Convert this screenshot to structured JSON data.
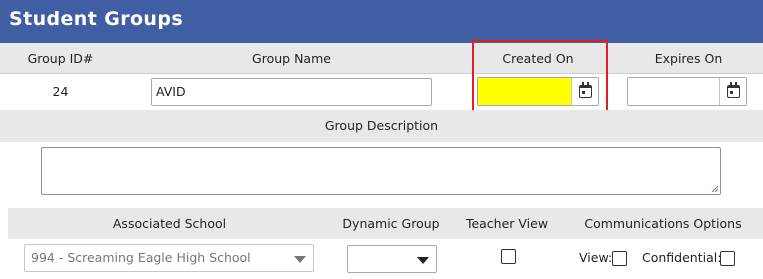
{
  "header": {
    "title": "Student Groups"
  },
  "columns": {
    "group_id": "Group ID#",
    "group_name": "Group Name",
    "created_on": "Created On",
    "expires_on": "Expires On"
  },
  "row": {
    "group_id": "24",
    "group_name": "AVID",
    "created_on": "",
    "expires_on": ""
  },
  "description": {
    "label": "Group Description",
    "value": ""
  },
  "associated": {
    "headers": {
      "school": "Associated School",
      "dynamic": "Dynamic Group",
      "teacher": "Teacher View",
      "comms": "Communications Options"
    },
    "school_value": "994 - Screaming Eagle High School",
    "dynamic_value": "",
    "view_label": "View:",
    "confidential_label": "Confidential:"
  },
  "colors": {
    "header_bg": "#3f5ea3",
    "created_on_fill": "#ffff00",
    "highlight_border": "#e02020"
  },
  "icons": [
    "calendar-icon",
    "chevron-down-icon",
    "resize-grip-icon"
  ]
}
